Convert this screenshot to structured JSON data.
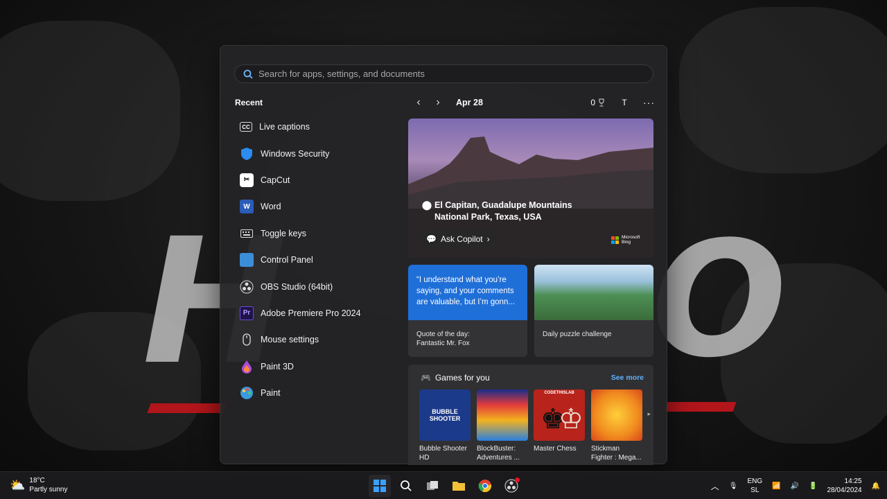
{
  "search": {
    "placeholder": "Search for apps, settings, and documents"
  },
  "recent": {
    "title": "Recent",
    "items": [
      {
        "label": "Live captions",
        "icon": "live-captions-icon"
      },
      {
        "label": "Windows Security",
        "icon": "shield-icon"
      },
      {
        "label": "CapCut",
        "icon": "capcut-icon"
      },
      {
        "label": "Word",
        "icon": "word-icon"
      },
      {
        "label": "Toggle keys",
        "icon": "keyboard-icon"
      },
      {
        "label": "Control Panel",
        "icon": "control-panel-icon"
      },
      {
        "label": "OBS Studio (64bit)",
        "icon": "obs-icon"
      },
      {
        "label": "Adobe Premiere Pro 2024",
        "icon": "premiere-icon"
      },
      {
        "label": "Mouse settings",
        "icon": "mouse-icon"
      },
      {
        "label": "Paint 3D",
        "icon": "paint3d-icon"
      },
      {
        "label": "Paint",
        "icon": "paint-icon"
      }
    ]
  },
  "widgets": {
    "date": "Apr 28",
    "reward_points": "0",
    "avatar_initial": "T",
    "hero": {
      "location": "El Capitan, Guadalupe Mountains National Park, Texas, USA",
      "copilot_label": "Ask Copilot",
      "brand": "Microsoft Bing"
    },
    "quote_card": {
      "quote": "“I understand what you’re saying, and your comments are valuable, but I’m gonn...",
      "caption_line1": "Quote of the day:",
      "caption_line2": "Fantastic Mr. Fox"
    },
    "puzzle_card": {
      "caption": "Daily puzzle challenge"
    },
    "games": {
      "title": "Games for you",
      "see_more": "See more",
      "items": [
        {
          "name": "Bubble Shooter HD",
          "thumb_label": "BUBBLE SHOOTER"
        },
        {
          "name": "BlockBuster: Adventures ...",
          "thumb_label": ""
        },
        {
          "name": "Master Chess",
          "thumb_label": "CODETHISLAB"
        },
        {
          "name": "Stickman Fighter : Mega...",
          "thumb_label": ""
        }
      ]
    }
  },
  "taskbar": {
    "weather_temp": "18°C",
    "weather_desc": "Partly sunny",
    "lang_line1": "ENG",
    "lang_line2": "SL",
    "time": "14:25",
    "date": "28/04/2024"
  },
  "colors": {
    "accent": "#1f6fd8",
    "link": "#5fb2ff",
    "panel_bg": "#242426"
  }
}
